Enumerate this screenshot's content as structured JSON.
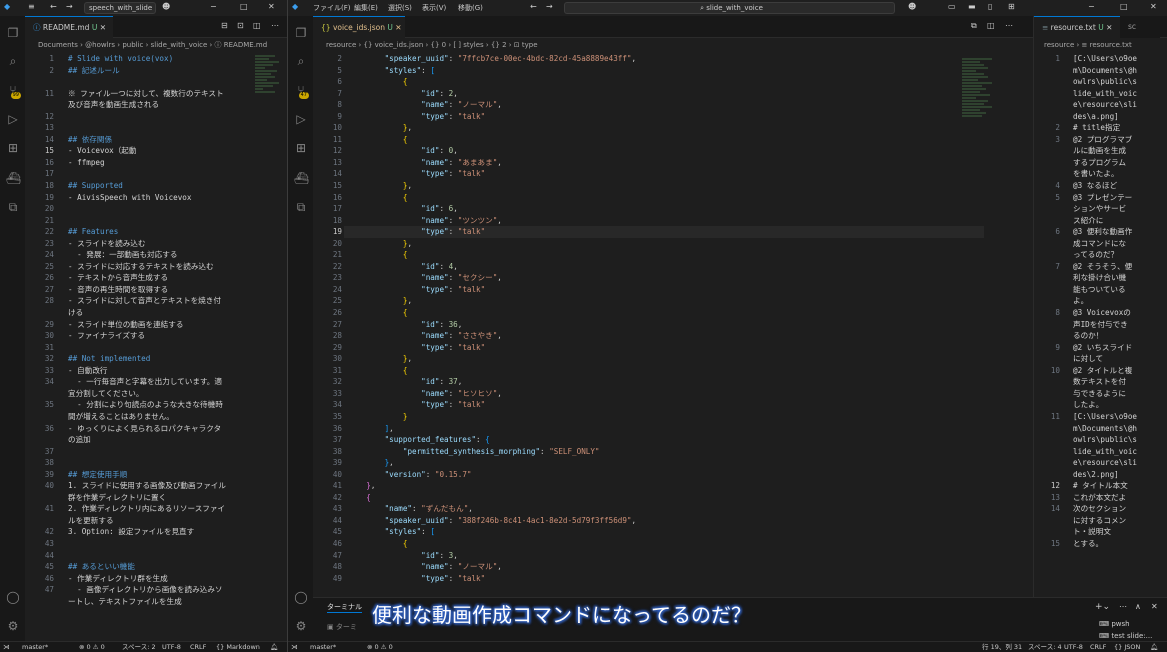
{
  "left_window": {
    "search": "speech_with_slide",
    "tab": {
      "file": "README.md",
      "status": "U"
    },
    "breadcrumb": "Documents › @howlrs › public › slide_with_voice › ⓘ README.md",
    "lines": [
      {
        "n": "1",
        "html": "<span class='h'># Slide with voice(vox)</span>"
      },
      {
        "n": "2",
        "html": "<span class='h'>## 記述ルール</span>"
      },
      {
        "n": "",
        "html": ""
      },
      {
        "n": "11",
        "html": "<span class='md'>※ ファイル一つに対して、複数行のテキスト</span>"
      },
      {
        "n": "",
        "html": "<span class='md'>及び音声を動画生成される</span>"
      },
      {
        "n": "12",
        "html": ""
      },
      {
        "n": "13",
        "html": ""
      },
      {
        "n": "14",
        "html": "<span class='h'>## 依存関係</span>"
      },
      {
        "n": "15",
        "html": "<span class='md'>- Voicevox（起動</span>",
        "cur": true
      },
      {
        "n": "16",
        "html": "<span class='md'>- ffmpeg</span>"
      },
      {
        "n": "17",
        "html": ""
      },
      {
        "n": "18",
        "html": "<span class='h'>## Supported</span>"
      },
      {
        "n": "19",
        "html": "<span class='md'>- AivisSpeech with Voicevox</span>"
      },
      {
        "n": "20",
        "html": ""
      },
      {
        "n": "21",
        "html": ""
      },
      {
        "n": "22",
        "html": "<span class='h'>## Features</span>"
      },
      {
        "n": "23",
        "html": "<span class='md'>- スライドを読み込む</span>"
      },
      {
        "n": "24",
        "html": "<span class='md'>  - 発展：一部動画も対応する</span>"
      },
      {
        "n": "25",
        "html": "<span class='md'>- スライドに対応するテキストを読み込む</span>"
      },
      {
        "n": "26",
        "html": "<span class='md'>- テキストから音声生成する</span>"
      },
      {
        "n": "27",
        "html": "<span class='md'>- 音声の再生時間を取得する</span>"
      },
      {
        "n": "28",
        "html": "<span class='md'>- スライドに対して音声とテキストを焼き付</span>"
      },
      {
        "n": "",
        "html": "<span class='md'>ける</span>"
      },
      {
        "n": "29",
        "html": "<span class='md'>- スライド単位の動画を連結する</span>"
      },
      {
        "n": "30",
        "html": "<span class='md'>- ファイナライズする</span>"
      },
      {
        "n": "31",
        "html": ""
      },
      {
        "n": "32",
        "html": "<span class='h'>## Not implemented</span>"
      },
      {
        "n": "33",
        "html": "<span class='md'>- 自動改行</span>"
      },
      {
        "n": "34",
        "html": "<span class='md'>  - 一行毎音声と字幕を出力しています。適</span>"
      },
      {
        "n": "",
        "html": "<span class='md'>宜分割してください。</span>"
      },
      {
        "n": "35",
        "html": "<span class='md'>  - 分割により句読点のような大きな待機時</span>"
      },
      {
        "n": "",
        "html": "<span class='md'>間が増えることはありません。</span>"
      },
      {
        "n": "36",
        "html": "<span class='md'>- ゆっくりによく見られるロパクキャラクタ</span>"
      },
      {
        "n": "",
        "html": "<span class='md'>の追加</span>"
      },
      {
        "n": "37",
        "html": ""
      },
      {
        "n": "38",
        "html": ""
      },
      {
        "n": "39",
        "html": "<span class='h'>## 想定使用手順</span>"
      },
      {
        "n": "40",
        "html": "<span class='md'>1. スライドに使用する画像及び動画ファイル</span>"
      },
      {
        "n": "",
        "html": "<span class='md'>群を作業ディレクトリに置く</span>"
      },
      {
        "n": "41",
        "html": "<span class='md'>2. 作業ディレクトリ内にあるリソースファイ</span>"
      },
      {
        "n": "",
        "html": "<span class='md'>ルを更新する</span>"
      },
      {
        "n": "42",
        "html": "<span class='md'>3. Option: 設定ファイルを見直す</span>"
      },
      {
        "n": "43",
        "html": ""
      },
      {
        "n": "44",
        "html": ""
      },
      {
        "n": "45",
        "html": "<span class='h'>## あるといい機能</span>"
      },
      {
        "n": "46",
        "html": "<span class='md'>- 作業ディレクトリ群を生成</span>"
      },
      {
        "n": "47",
        "html": "<span class='md'>  - 画像ディレクトリから画像を読み込みソ</span>"
      },
      {
        "n": "",
        "html": "<span class='md'>ートし、テキストファイルを生成</span>"
      }
    ],
    "status": {
      "branch": "master*",
      "problems": "⊗ 0 ⚠ 0",
      "spaces": "スペース: 2",
      "encoding": "UTF-8",
      "eol": "CRLF",
      "lang": "{} Markdown"
    }
  },
  "right_window": {
    "menu": [
      "ファイル(F)",
      "編集(E)",
      "選択(S)",
      "表示(V)",
      "移動(G)"
    ],
    "search": "slide_with_voice",
    "tab_main": {
      "file": "voice_ids.json",
      "status": "U"
    },
    "tab_side": {
      "file": "resource.txt",
      "status": "U"
    },
    "tab_side2": "sc",
    "breadcrumb": "resource › {} voice_ids.json › {} 0 › [ ] styles › {} 2 › ⊡ type",
    "breadcrumb_side": "resource › ≡ resource.txt",
    "json_lines": [
      {
        "n": "2",
        "html": "        <span class='k'>\"speaker_uuid\"</span><span class='p'>: </span><span class='s'>\"7ffcb7ce-00ec-4bdc-82cd-45a8889e43ff\"</span><span class='p'>,</span>"
      },
      {
        "n": "5",
        "html": "        <span class='k'>\"styles\"</span><span class='p'>: </span><span class='b3'>[</span>"
      },
      {
        "n": "6",
        "html": "            <span class='b'>{</span>"
      },
      {
        "n": "7",
        "html": "                <span class='k'>\"id\"</span><span class='p'>: </span><span class='n'>2</span><span class='p'>,</span>"
      },
      {
        "n": "8",
        "html": "                <span class='k'>\"name\"</span><span class='p'>: </span><span class='s'>\"ノーマル\"</span><span class='p'>,</span>"
      },
      {
        "n": "9",
        "html": "                <span class='k'>\"type\"</span><span class='p'>: </span><span class='s'>\"talk\"</span>"
      },
      {
        "n": "10",
        "html": "            <span class='b'>}</span><span class='p'>,</span>"
      },
      {
        "n": "11",
        "html": "            <span class='b'>{</span>"
      },
      {
        "n": "12",
        "html": "                <span class='k'>\"id\"</span><span class='p'>: </span><span class='n'>0</span><span class='p'>,</span>"
      },
      {
        "n": "13",
        "html": "                <span class='k'>\"name\"</span><span class='p'>: </span><span class='s'>\"あまあま\"</span><span class='p'>,</span>"
      },
      {
        "n": "14",
        "html": "                <span class='k'>\"type\"</span><span class='p'>: </span><span class='s'>\"talk\"</span>"
      },
      {
        "n": "15",
        "html": "            <span class='b'>}</span><span class='p'>,</span>"
      },
      {
        "n": "16",
        "html": "            <span class='b'>{</span>"
      },
      {
        "n": "17",
        "html": "                <span class='k'>\"id\"</span><span class='p'>: </span><span class='n'>6</span><span class='p'>,</span>"
      },
      {
        "n": "18",
        "html": "                <span class='k'>\"name\"</span><span class='p'>: </span><span class='s'>\"ツンツン\"</span><span class='p'>,</span>"
      },
      {
        "n": "19",
        "html": "                <span class='k'>\"type\"</span><span class='p'>: </span><span class='s'>\"talk\"</span>",
        "cur": true
      },
      {
        "n": "20",
        "html": "            <span class='b'>}</span><span class='p'>,</span>"
      },
      {
        "n": "21",
        "html": "            <span class='b'>{</span>"
      },
      {
        "n": "22",
        "html": "                <span class='k'>\"id\"</span><span class='p'>: </span><span class='n'>4</span><span class='p'>,</span>"
      },
      {
        "n": "23",
        "html": "                <span class='k'>\"name\"</span><span class='p'>: </span><span class='s'>\"セクシー\"</span><span class='p'>,</span>"
      },
      {
        "n": "24",
        "html": "                <span class='k'>\"type\"</span><span class='p'>: </span><span class='s'>\"talk\"</span>"
      },
      {
        "n": "25",
        "html": "            <span class='b'>}</span><span class='p'>,</span>"
      },
      {
        "n": "26",
        "html": "            <span class='b'>{</span>"
      },
      {
        "n": "27",
        "html": "                <span class='k'>\"id\"</span><span class='p'>: </span><span class='n'>36</span><span class='p'>,</span>"
      },
      {
        "n": "28",
        "html": "                <span class='k'>\"name\"</span><span class='p'>: </span><span class='s'>\"ささやき\"</span><span class='p'>,</span>"
      },
      {
        "n": "29",
        "html": "                <span class='k'>\"type\"</span><span class='p'>: </span><span class='s'>\"talk\"</span>"
      },
      {
        "n": "30",
        "html": "            <span class='b'>}</span><span class='p'>,</span>"
      },
      {
        "n": "31",
        "html": "            <span class='b'>{</span>"
      },
      {
        "n": "32",
        "html": "                <span class='k'>\"id\"</span><span class='p'>: </span><span class='n'>37</span><span class='p'>,</span>"
      },
      {
        "n": "33",
        "html": "                <span class='k'>\"name\"</span><span class='p'>: </span><span class='s'>\"ヒソヒソ\"</span><span class='p'>,</span>"
      },
      {
        "n": "34",
        "html": "                <span class='k'>\"type\"</span><span class='p'>: </span><span class='s'>\"talk\"</span>"
      },
      {
        "n": "35",
        "html": "            <span class='b'>}</span>"
      },
      {
        "n": "36",
        "html": "        <span class='b3'>]</span><span class='p'>,</span>"
      },
      {
        "n": "37",
        "html": "        <span class='k'>\"supported_features\"</span><span class='p'>: </span><span class='b3'>{</span>"
      },
      {
        "n": "38",
        "html": "            <span class='k'>\"permitted_synthesis_morphing\"</span><span class='p'>: </span><span class='s'>\"SELF_ONLY\"</span>"
      },
      {
        "n": "39",
        "html": "        <span class='b3'>}</span><span class='p'>,</span>"
      },
      {
        "n": "40",
        "html": "        <span class='k'>\"version\"</span><span class='p'>: </span><span class='s'>\"0.15.7\"</span>"
      },
      {
        "n": "41",
        "html": "    <span class='b2'>}</span><span class='p'>,</span>"
      },
      {
        "n": "42",
        "html": "    <span class='b2'>{</span>"
      },
      {
        "n": "43",
        "html": "        <span class='k'>\"name\"</span><span class='p'>: </span><span class='s'>\"ずんだもん\"</span><span class='p'>,</span>"
      },
      {
        "n": "44",
        "html": "        <span class='k'>\"speaker_uuid\"</span><span class='p'>: </span><span class='s'>\"388f246b-8c41-4ac1-8e2d-5d79f3ff56d9\"</span><span class='p'>,</span>"
      },
      {
        "n": "45",
        "html": "        <span class='k'>\"styles\"</span><span class='p'>: </span><span class='b3'>[</span>"
      },
      {
        "n": "46",
        "html": "            <span class='b'>{</span>"
      },
      {
        "n": "47",
        "html": "                <span class='k'>\"id\"</span><span class='p'>: </span><span class='n'>3</span><span class='p'>,</span>"
      },
      {
        "n": "48",
        "html": "                <span class='k'>\"name\"</span><span class='p'>: </span><span class='s'>\"ノーマル\"</span><span class='p'>,</span>"
      },
      {
        "n": "49",
        "html": "                <span class='k'>\"type\"</span><span class='p'>: </span><span class='s'>\"talk\"</span>"
      }
    ],
    "resource_lines": [
      {
        "n": "1",
        "text": "[C:\\Users\\o9oe\nm\\Documents\\@h\nowlrs\\public\\s\nlide_with_voic\ne\\resource\\sli\ndes\\a.png]"
      },
      {
        "n": "2",
        "text": "# title指定"
      },
      {
        "n": "3",
        "text": "@2 プログラマブ\nルに動画を生成\nするプログラム\nを書いたよ。"
      },
      {
        "n": "4",
        "text": "@3 なるほど"
      },
      {
        "n": "5",
        "text": "@3 プレゼンテー\nションやサービ\nス紹介に"
      },
      {
        "n": "6",
        "text": "@3 便利な動画作\n成コマンドにな\nってるのだ？"
      },
      {
        "n": "7",
        "text": "@2 そうそう、便\n利な掛け合い機\n能もついている\nよ。"
      },
      {
        "n": "8",
        "text": "@3 Voicevoxの\n声IDを付与でき\nるのか！"
      },
      {
        "n": "9",
        "text": "@2 いちスライド\nに対して"
      },
      {
        "n": "10",
        "text": "@2 タイトルと複\n数テキストを付\n与できるように\nしたよ。"
      },
      {
        "n": "11",
        "text": "[C:\\Users\\o9oe\nm\\Documents\\@h\nowlrs\\public\\s\nlide_with_voic\ne\\resource\\sli\ndes\\2.png]"
      },
      {
        "n": "12",
        "text": "# タイトル本文"
      },
      {
        "n": "13",
        "text": "これが本文だよ"
      },
      {
        "n": "14",
        "text": "次のセクション\nに対するコメン\nト・説明文"
      },
      {
        "n": "15",
        "text": "とする。"
      }
    ],
    "panel": {
      "tab": "ターミナル",
      "prompt": "ターミ",
      "terminals": [
        "pwsh",
        "test slide:..."
      ]
    },
    "status": {
      "branch": "master*",
      "problems": "⊗ 0 ⚠ 0",
      "position": "行 19、列 31",
      "spaces": "スペース: 4",
      "encoding": "UTF-8",
      "eol": "CRLF",
      "lang": "{} JSON"
    }
  },
  "subtitle": "便利な動画作成コマンドになってるのだ？"
}
